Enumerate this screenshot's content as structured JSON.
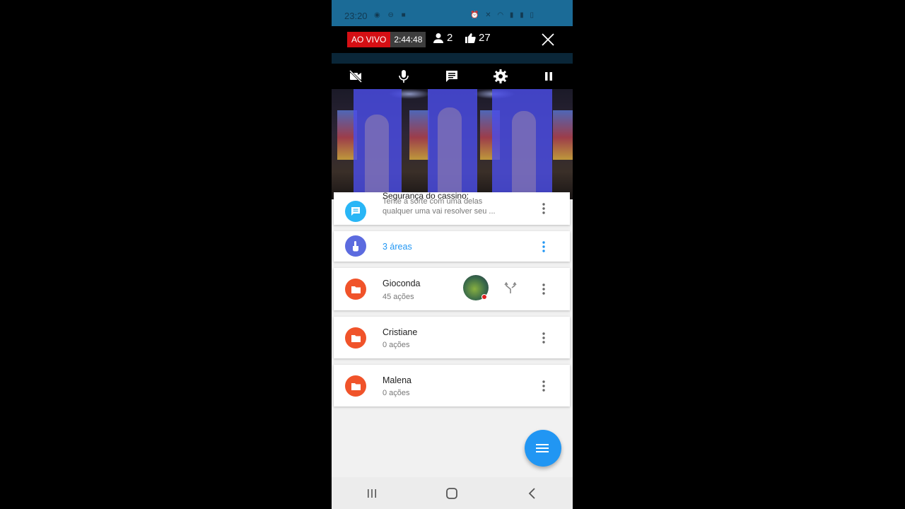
{
  "status_bar": {
    "time": "23:20"
  },
  "live": {
    "badge": "AO VIVO",
    "elapsed": "2:44:48",
    "viewers": "2",
    "likes": "27"
  },
  "controls": [
    "camera-off-icon",
    "microphone-icon",
    "chat-icon",
    "settings-icon",
    "pause-icon"
  ],
  "list": {
    "first_item": {
      "title": "Segurança do cassino:",
      "line1": "Tente a sorte com uma delas",
      "line2": "qualquer uma vai resolver seu ..."
    },
    "areas_item": {
      "title": "3 áreas"
    },
    "folders": [
      {
        "name": "Gioconda",
        "count": "45 ações"
      },
      {
        "name": "Cristiane",
        "count": "0 ações"
      },
      {
        "name": "Malena",
        "count": "0 ações"
      }
    ]
  },
  "colors": {
    "accent": "#2196f3",
    "folder": "#f0532a",
    "chat_icon": "#29b6f6",
    "touch_icon": "#5c6bdf",
    "live": "#d50f14"
  }
}
